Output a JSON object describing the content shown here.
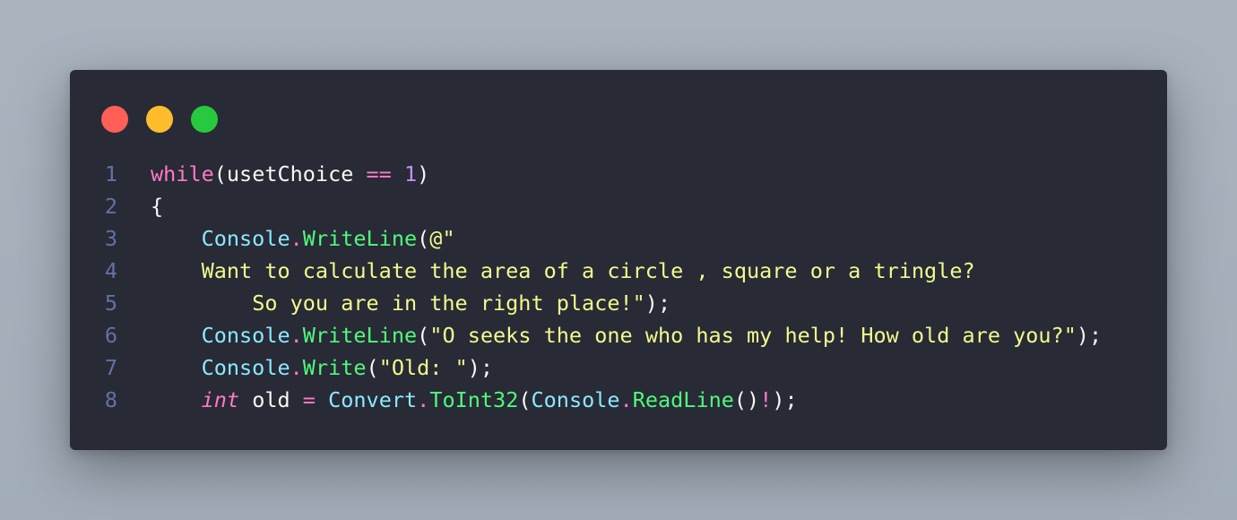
{
  "theme": {
    "background": "#282a36",
    "traffic_lights": [
      "#ff5f56",
      "#ffbd2e",
      "#27c93f"
    ],
    "colors": {
      "plain": "#f8f8f2",
      "keyword": "#ff79c6",
      "number": "#bd93f9",
      "class": "#8be9fd",
      "method": "#50fa7b",
      "string": "#f1fa8c",
      "line_number": "#6272a4"
    }
  },
  "window": {
    "traffic_light_icons": [
      "close-dot-icon",
      "minimize-dot-icon",
      "maximize-dot-icon"
    ]
  },
  "code_lines": [
    {
      "number": "1",
      "tokens": [
        {
          "text": "while",
          "type": "keyword"
        },
        {
          "text": "(usetChoice ",
          "type": "plain"
        },
        {
          "text": "==",
          "type": "keyword"
        },
        {
          "text": " ",
          "type": "plain"
        },
        {
          "text": "1",
          "type": "number"
        },
        {
          "text": ")",
          "type": "plain"
        }
      ]
    },
    {
      "number": "2",
      "tokens": [
        {
          "text": "{",
          "type": "plain"
        }
      ]
    },
    {
      "number": "3",
      "tokens": [
        {
          "text": "    ",
          "type": "plain"
        },
        {
          "text": "Console",
          "type": "class"
        },
        {
          "text": ".",
          "type": "keyword"
        },
        {
          "text": "WriteLine",
          "type": "method"
        },
        {
          "text": "(",
          "type": "plain"
        },
        {
          "text": "@\"",
          "type": "string"
        }
      ]
    },
    {
      "number": "4",
      "tokens": [
        {
          "text": "    ",
          "type": "plain"
        },
        {
          "text": "Want to calculate the area of a circle , square or a tringle?",
          "type": "string"
        }
      ]
    },
    {
      "number": "5",
      "tokens": [
        {
          "text": "        ",
          "type": "plain"
        },
        {
          "text": "So you are in the right place!\"",
          "type": "string"
        },
        {
          "text": ");",
          "type": "plain"
        }
      ]
    },
    {
      "number": "6",
      "tokens": [
        {
          "text": "    ",
          "type": "plain"
        },
        {
          "text": "Console",
          "type": "class"
        },
        {
          "text": ".",
          "type": "keyword"
        },
        {
          "text": "WriteLine",
          "type": "method"
        },
        {
          "text": "(",
          "type": "plain"
        },
        {
          "text": "\"O seeks the one who has my help! How old are you?\"",
          "type": "string"
        },
        {
          "text": ");",
          "type": "plain"
        }
      ]
    },
    {
      "number": "7",
      "tokens": [
        {
          "text": "    ",
          "type": "plain"
        },
        {
          "text": "Console",
          "type": "class"
        },
        {
          "text": ".",
          "type": "keyword"
        },
        {
          "text": "Write",
          "type": "method"
        },
        {
          "text": "(",
          "type": "plain"
        },
        {
          "text": "\"Old: \"",
          "type": "string"
        },
        {
          "text": ");",
          "type": "plain"
        }
      ]
    },
    {
      "number": "8",
      "tokens": [
        {
          "text": "    ",
          "type": "plain"
        },
        {
          "text": "int",
          "type": "type_italic"
        },
        {
          "text": " old ",
          "type": "plain"
        },
        {
          "text": "=",
          "type": "keyword"
        },
        {
          "text": " ",
          "type": "plain"
        },
        {
          "text": "Convert",
          "type": "class"
        },
        {
          "text": ".",
          "type": "keyword"
        },
        {
          "text": "ToInt32",
          "type": "method"
        },
        {
          "text": "(",
          "type": "plain"
        },
        {
          "text": "Console",
          "type": "class"
        },
        {
          "text": ".",
          "type": "keyword"
        },
        {
          "text": "ReadLine",
          "type": "method"
        },
        {
          "text": "()",
          "type": "plain"
        },
        {
          "text": "!",
          "type": "keyword"
        },
        {
          "text": ");",
          "type": "plain"
        }
      ]
    }
  ]
}
